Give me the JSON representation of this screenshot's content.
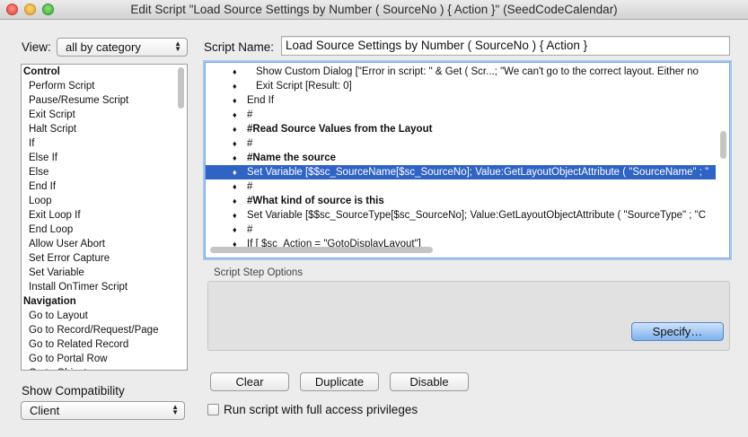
{
  "window": {
    "title": "Edit Script \"Load Source Settings by Number ( SourceNo ) { Action }\" (SeedCodeCalendar)"
  },
  "view": {
    "label": "View:",
    "selected": "all by category"
  },
  "script_name": {
    "label": "Script Name:",
    "value": "Load Source Settings by Number ( SourceNo ) { Action }"
  },
  "step_list": {
    "items": [
      {
        "text": "Control",
        "type": "category"
      },
      {
        "text": "Perform Script",
        "type": "step"
      },
      {
        "text": "Pause/Resume Script",
        "type": "step"
      },
      {
        "text": "Exit Script",
        "type": "step"
      },
      {
        "text": "Halt Script",
        "type": "step"
      },
      {
        "text": "If",
        "type": "step"
      },
      {
        "text": "Else If",
        "type": "step"
      },
      {
        "text": "Else",
        "type": "step"
      },
      {
        "text": "End If",
        "type": "step"
      },
      {
        "text": "Loop",
        "type": "step"
      },
      {
        "text": "Exit Loop If",
        "type": "step"
      },
      {
        "text": "End Loop",
        "type": "step"
      },
      {
        "text": "Allow User Abort",
        "type": "step"
      },
      {
        "text": "Set Error Capture",
        "type": "step"
      },
      {
        "text": "Set Variable",
        "type": "step"
      },
      {
        "text": "Install OnTimer Script",
        "type": "step"
      },
      {
        "text": "Navigation",
        "type": "category"
      },
      {
        "text": "Go to Layout",
        "type": "step"
      },
      {
        "text": "Go to Record/Request/Page",
        "type": "step"
      },
      {
        "text": "Go to Related Record",
        "type": "step"
      },
      {
        "text": "Go to Portal Row",
        "type": "step"
      },
      {
        "text": "Go to Object",
        "type": "step"
      }
    ]
  },
  "script_lines": [
    {
      "indent": 2,
      "text": "Show Custom Dialog [\"Error in script: \" & Get ( Scr...; \"We can't go to the correct layout. Either no",
      "bold": false,
      "selected": false
    },
    {
      "indent": 2,
      "text": "Exit Script [Result: 0]",
      "bold": false,
      "selected": false
    },
    {
      "indent": 1,
      "text": "End If",
      "bold": false,
      "selected": false
    },
    {
      "indent": 1,
      "text": "#",
      "bold": false,
      "selected": false
    },
    {
      "indent": 1,
      "text": "#Read Source Values from the Layout",
      "bold": true,
      "selected": false
    },
    {
      "indent": 1,
      "text": "#",
      "bold": false,
      "selected": false
    },
    {
      "indent": 1,
      "text": "#Name the source",
      "bold": true,
      "selected": false
    },
    {
      "indent": 1,
      "text": "Set Variable [$$sc_SourceName[$sc_SourceNo]; Value:GetLayoutObjectAttribute ( \"SourceName\" ; \"",
      "bold": false,
      "selected": true
    },
    {
      "indent": 1,
      "text": "#",
      "bold": false,
      "selected": false
    },
    {
      "indent": 1,
      "text": "#What kind of source is this",
      "bold": true,
      "selected": false
    },
    {
      "indent": 1,
      "text": "Set Variable [$$sc_SourceType[$sc_SourceNo]; Value:GetLayoutObjectAttribute ( \"SourceType\" ; \"C",
      "bold": false,
      "selected": false
    },
    {
      "indent": 1,
      "text": "#",
      "bold": false,
      "selected": false
    },
    {
      "indent": 1,
      "text": "If [ $sc_Action = \"GotoDisplayLayout\"]",
      "bold": false,
      "selected": false
    }
  ],
  "step_options": {
    "label": "Script Step Options",
    "specify_button": "Specify…"
  },
  "buttons": {
    "clear": "Clear",
    "duplicate": "Duplicate",
    "disable": "Disable"
  },
  "compatibility": {
    "label": "Show Compatibility",
    "selected": "Client"
  },
  "full_access": {
    "label": "Run script with full access privileges",
    "checked": false
  }
}
